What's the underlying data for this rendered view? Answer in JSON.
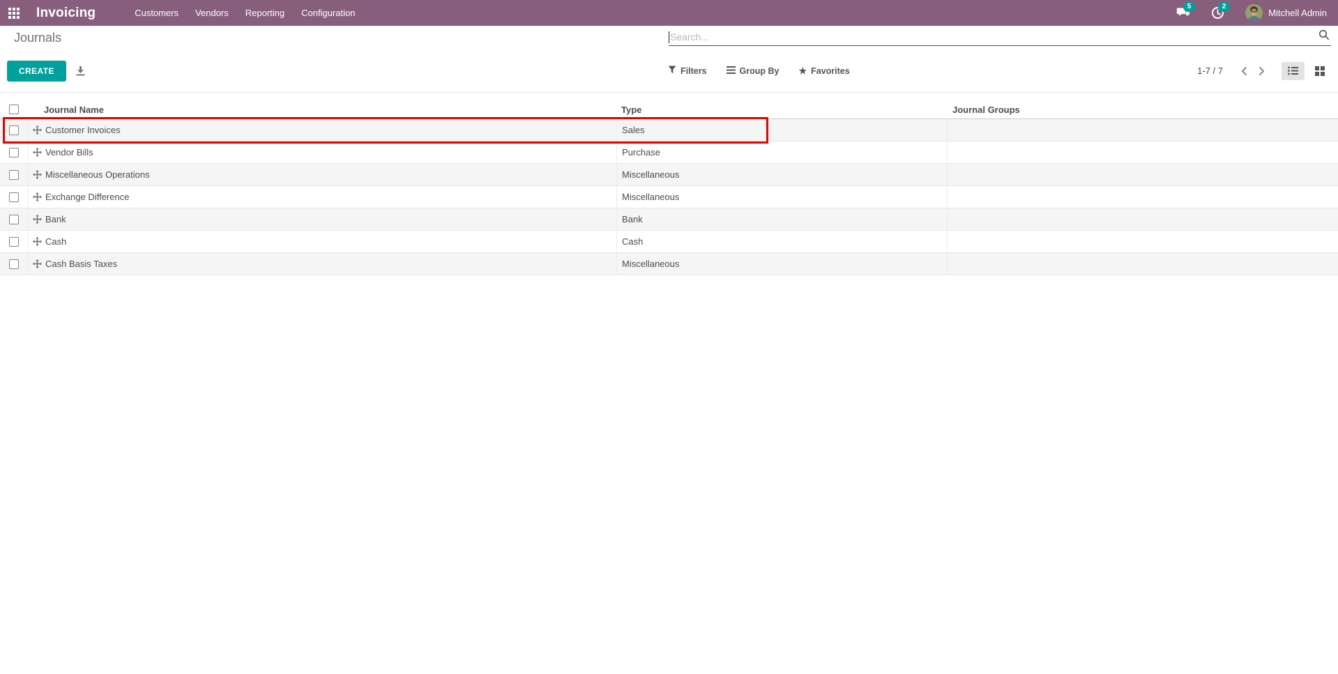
{
  "colors": {
    "navbar_bg": "#875f7d",
    "accent": "#00a09d",
    "highlight": "#e60000"
  },
  "navbar": {
    "app_title": "Invoicing",
    "menus": [
      "Customers",
      "Vendors",
      "Reporting",
      "Configuration"
    ],
    "messages_count": "5",
    "activities_count": "2",
    "user_name": "Mitchell Admin"
  },
  "control_panel": {
    "breadcrumb": "Journals",
    "search_placeholder": "Search...",
    "create_label": "CREATE",
    "filters_label": "Filters",
    "group_by_label": "Group By",
    "favorites_label": "Favorites",
    "pager": "1-7 / 7"
  },
  "table": {
    "columns": [
      "Journal Name",
      "Type",
      "Journal Groups"
    ],
    "rows": [
      {
        "name": "Customer Invoices",
        "type": "Sales",
        "groups": "",
        "highlighted": true
      },
      {
        "name": "Vendor Bills",
        "type": "Purchase",
        "groups": ""
      },
      {
        "name": "Miscellaneous Operations",
        "type": "Miscellaneous",
        "groups": ""
      },
      {
        "name": "Exchange Difference",
        "type": "Miscellaneous",
        "groups": ""
      },
      {
        "name": "Bank",
        "type": "Bank",
        "groups": ""
      },
      {
        "name": "Cash",
        "type": "Cash",
        "groups": ""
      },
      {
        "name": "Cash Basis Taxes",
        "type": "Miscellaneous",
        "groups": ""
      }
    ]
  }
}
